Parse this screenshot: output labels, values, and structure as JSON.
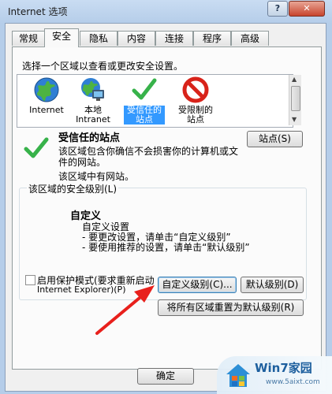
{
  "window": {
    "title": "Internet 选项",
    "help_label": "?",
    "close_label": "✕"
  },
  "tabs": [
    "常规",
    "安全",
    "隐私",
    "内容",
    "连接",
    "程序",
    "高级"
  ],
  "active_tab": "安全",
  "security": {
    "instruction": "选择一个区域以查看或更改安全设置。",
    "zones": [
      {
        "line1": "Internet",
        "line2": "",
        "icon": "globe-icon"
      },
      {
        "line1": "本地",
        "line2": "Intranet",
        "icon": "local-intranet-icon"
      },
      {
        "line1": "受信任的",
        "line2": "站点",
        "icon": "checkmark-icon",
        "selected": true
      },
      {
        "line1": "受限制的",
        "line2": "站点",
        "icon": "restricted-icon"
      }
    ],
    "zone_title": "受信任的站点",
    "zone_desc_1": "该区域包含你确信不会损害你的计算机或文",
    "zone_desc_2": "件的网站。",
    "zone_desc_3": "该区域中有网站。",
    "sites_button": "站点(S)"
  },
  "level_group": {
    "title": "该区域的安全级别(L)",
    "custom_heading": "自定义",
    "custom_line_1": "自定义设置",
    "custom_line_2": "- 要更改设置，请单击“自定义级别”",
    "custom_line_3": "- 要使用推荐的设置，请单击“默认级别”",
    "protected_mode_1": "启用保护模式(要求重新启动",
    "protected_mode_2": "Internet Explorer)(P)",
    "protected_mode_checked": false,
    "custom_level_button": "自定义级别(C)...",
    "default_level_button": "默认级别(D)"
  },
  "reset_all_button": "将所有区域重置为默认级别(R)",
  "footer": {
    "ok_button": "确定"
  },
  "watermark": {
    "title": "Win7家园",
    "url": "www.5aixt.com"
  },
  "colors": {
    "selection": "#3399ff",
    "arrow": "#e8201c",
    "check_green": "#37b24a",
    "restricted_red": "#d8231a"
  }
}
